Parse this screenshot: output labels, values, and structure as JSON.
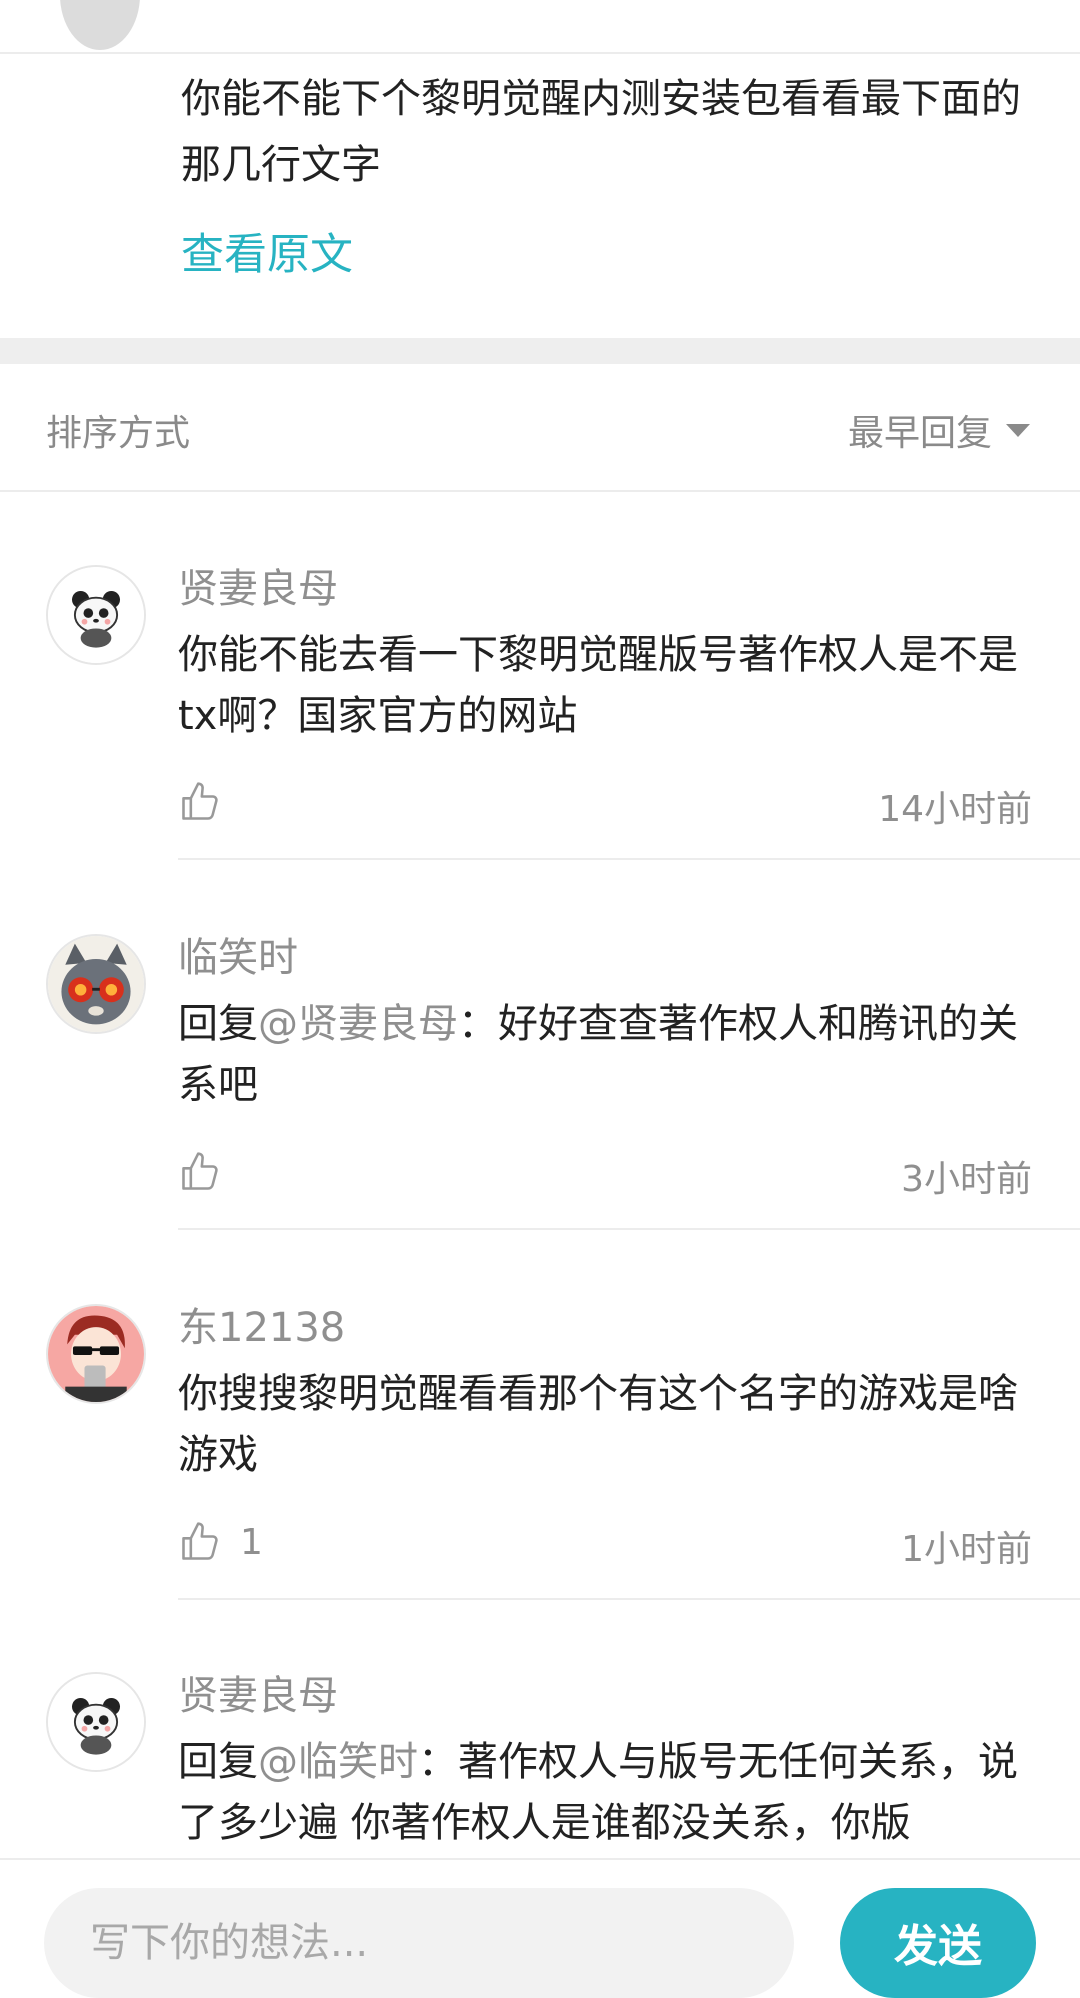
{
  "original": {
    "text": "你能不能下个黎明觉醒内测安装包看看最下面的那几行文字",
    "view_original": "查看原文"
  },
  "sort": {
    "label": "排序方式",
    "selected": "最早回复"
  },
  "comments": [
    {
      "user": "贤妻良母",
      "prefix": "",
      "mention": "",
      "body": "你能不能去看一下黎明觉醒版号著作权人是不是tx啊？国家官方的网站",
      "likes": "",
      "time": "14小时前",
      "avatar": "panda-avatar"
    },
    {
      "user": "临笑时",
      "prefix": "回复",
      "mention": "@贤妻良母",
      "body": "：好好查查著作权人和腾讯的关系吧",
      "likes": "",
      "time": "3小时前",
      "avatar": "cat-avatar"
    },
    {
      "user": "东12138",
      "prefix": "",
      "mention": "",
      "body": "你搜搜黎明觉醒看看那个有这个名字的游戏是啥游戏",
      "likes": "1",
      "time": "1小时前",
      "avatar": "cartoon-boy-avatar"
    },
    {
      "user": "贤妻良母",
      "prefix": "回复",
      "mention": "@临笑时",
      "body": "：著作权人与版号无任何关系，说了多少遍 你著作权人是谁都没关系，你版",
      "likes": "",
      "time": "",
      "avatar": "panda-avatar"
    }
  ],
  "composer": {
    "placeholder": "写下你的想法...",
    "send_label": "发送"
  },
  "colors": {
    "accent": "#27b3c2",
    "muted": "#8f8f8f"
  }
}
